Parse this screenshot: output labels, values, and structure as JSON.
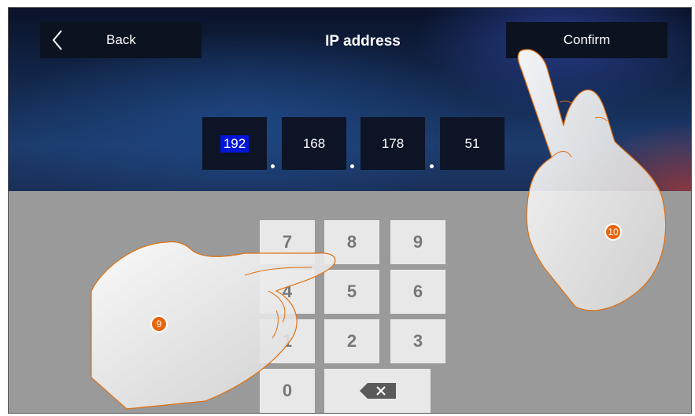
{
  "header": {
    "back_label": "Back",
    "title": "IP address",
    "confirm_label": "Confirm"
  },
  "ip": {
    "octets": [
      "192",
      "168",
      "178",
      "51"
    ]
  },
  "keypad": {
    "rows": [
      [
        "7",
        "8",
        "9"
      ],
      [
        "4",
        "5",
        "6"
      ],
      [
        "1",
        "2",
        "3"
      ]
    ],
    "zero": "0",
    "delete_icon": "backspace-icon"
  },
  "annotations": {
    "badge_left": "9",
    "badge_right": "10"
  },
  "colors": {
    "selection": "#0016d6",
    "badge": "#e8650a",
    "keypad_bg": "#9a9a9a",
    "key_bg": "#e8e8e8"
  }
}
